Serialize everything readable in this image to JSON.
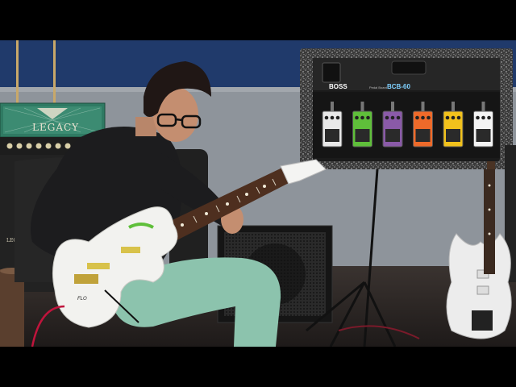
{
  "amp": {
    "brand": "LEGACY",
    "brand_small": "LEGACY"
  },
  "pedalboard": {
    "logo": "BOSS",
    "subtitle": "Pedal Board",
    "model": "BCB-60"
  },
  "guitar": {
    "headstock_text": "FLO"
  },
  "colors": {
    "wall_blue": "#203a6b",
    "wall_gray": "#8e949b",
    "amp_green": "#2f7a63",
    "pants": "#8cc3ad",
    "shirt": "#1c1c1e",
    "guitar_body": "#f2f2ef",
    "pedal_colors": [
      "#e9e9e9",
      "#5fbf3a",
      "#8a5aa8",
      "#ee6a2a",
      "#f2c21c",
      "#f4f4f4"
    ]
  },
  "pedals": [
    {
      "color": "#e9e9e9"
    },
    {
      "color": "#5fbf3a"
    },
    {
      "color": "#8a5aa8"
    },
    {
      "color": "#ee6a2a"
    },
    {
      "color": "#f2c21c"
    },
    {
      "color": "#f4f4f4"
    }
  ]
}
